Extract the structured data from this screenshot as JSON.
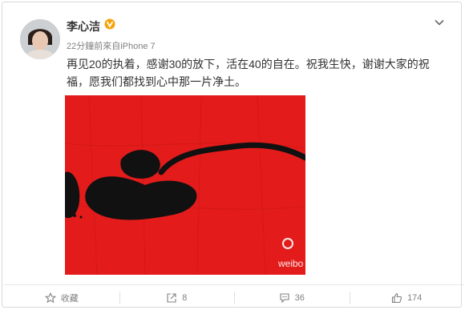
{
  "post": {
    "username": "李心洁",
    "meta": "22分鐘前來自iPhone 7",
    "content": "再见20的执着，感谢30的放下，活在40的自在。祝我生快，谢谢大家的祝福，愿我们都找到心中那一片净土。",
    "icons": {
      "verify": "verified-badge-icon",
      "menu": "chevron-down-icon"
    }
  },
  "photo": {
    "description_colors": {
      "background": "#e31b1b",
      "ink": "#111111"
    },
    "watermark": "weibo"
  },
  "actions": [
    {
      "label": "收藏",
      "icon": "star-icon"
    },
    {
      "label": "8",
      "icon": "share-icon"
    },
    {
      "label": "36",
      "icon": "comment-icon"
    },
    {
      "label": "174",
      "icon": "thumbs-up-icon"
    }
  ]
}
